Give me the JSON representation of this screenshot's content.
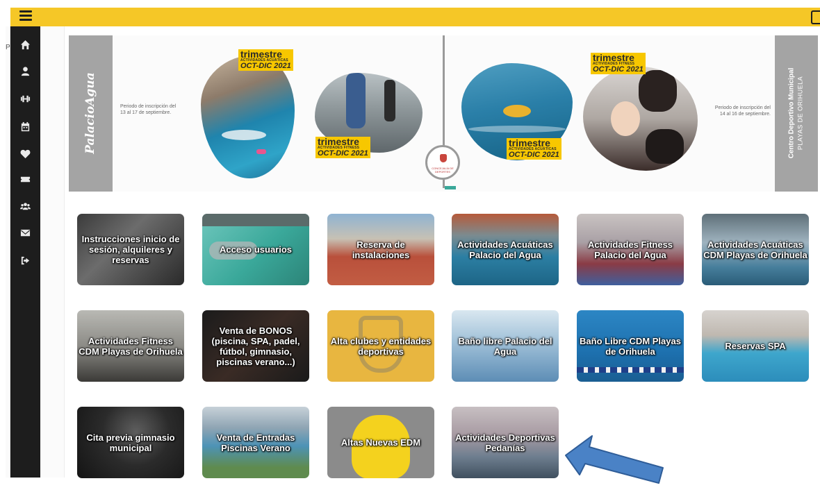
{
  "sidebar": {
    "cut_label": "P",
    "items": [
      {
        "name": "home-icon"
      },
      {
        "name": "user-icon"
      },
      {
        "name": "dumbbell-icon"
      },
      {
        "name": "calendar-icon"
      },
      {
        "name": "heartbeat-icon"
      },
      {
        "name": "ticket-icon"
      },
      {
        "name": "users-icon"
      },
      {
        "name": "envelope-icon"
      },
      {
        "name": "sign-out-icon"
      }
    ]
  },
  "banner": {
    "left_brand": "PalacioAgua",
    "left_period": "Periodo de inscripción del\n13 al 17 de septiembre.",
    "right_title": "Centro Deportivo Municipal",
    "right_subtitle": "PLAYAS DE ORIHUELA",
    "right_period": "Periodo de inscripción del\n14 al 16 de septiembre.",
    "seal_text": "CONCEJALÍA DE DEPORTES",
    "badges": [
      {
        "title": "trimestre",
        "subtitle": "ACTIVIDADES ACUÁTICAS",
        "date": "OCT-DIC 2021"
      },
      {
        "title": "trimestre",
        "subtitle": "ACTIVIDADES FITNESS",
        "date": "OCT-DIC 2021"
      },
      {
        "title": "trimestre",
        "subtitle": "ACTIVIDADES ACUÁTICAS",
        "date": "OCT-DIC 2021"
      },
      {
        "title": "trimestre",
        "subtitle": "ACTIVIDADES FITNESS",
        "date": "OCT-DIC 2021"
      }
    ]
  },
  "tiles": [
    {
      "label": "Instrucciones inicio de sesión, alquileres y reservas"
    },
    {
      "label": "Acceso usuarios"
    },
    {
      "label": "Reserva de instalaciones"
    },
    {
      "label": "Actividades Acuáticas Palacio del Agua"
    },
    {
      "label": "Actividades Fitness Palacio del Agua"
    },
    {
      "label": "Actividades Acuáticas CDM Playas de Orihuela"
    },
    {
      "label": "Actividades Fitness CDM Playas de Orihuela"
    },
    {
      "label": "Venta de BONOS (piscina, SPA, padel, fútbol, gimnasio, piscinas verano...)"
    },
    {
      "label": "Alta clubes y entidades deportivas"
    },
    {
      "label": "Baño libre Palacio del Agua"
    },
    {
      "label": "Baño Libre CDM Playas de Orihuela"
    },
    {
      "label": "Reservas SPA"
    },
    {
      "label": "Cita previa gimnasio municipal"
    },
    {
      "label": "Venta de Entradas Piscinas Verano"
    },
    {
      "label": "Altas Nuevas EDM"
    },
    {
      "label": "Actividades Deportivas Pedanías"
    }
  ],
  "colors": {
    "topbar": "#f5c727",
    "sidebar": "#1d1d1d",
    "arrow": "#4a82c6",
    "accent_teal": "#3aa89a"
  }
}
